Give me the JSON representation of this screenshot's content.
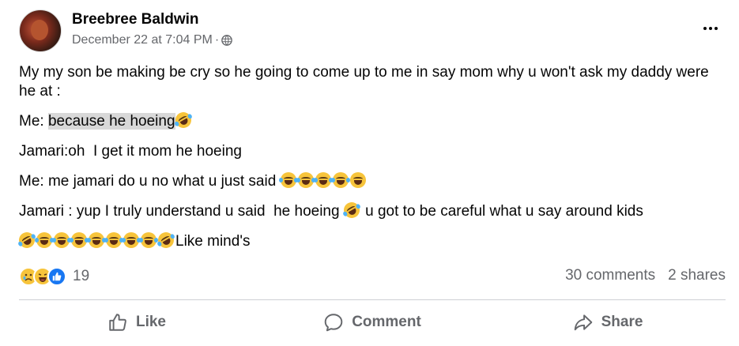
{
  "post": {
    "author": "Breebree Baldwin",
    "timestamp": "December 22 at 7:04 PM",
    "separator": "·",
    "audience_icon": "globe-icon",
    "more_icon": "more-options-icon"
  },
  "content": {
    "line1": "My my son be making be cry so he going to come up to me in say mom why u won't ask my daddy were he at :",
    "line2_prefix": "Me: ",
    "line2_highlight": "because he hoeing",
    "line3": "Jamari:oh  I get it mom he hoeing",
    "line4": "Me: me jamari do u no what u just said ",
    "line5_a": "Jamari : yup I truly understand u said  he hoeing ",
    "line5_b": " u got to be careful what u say around kids",
    "line6_suffix": "Like mind's"
  },
  "stats": {
    "reaction_count": "19",
    "comments": "30 comments",
    "shares": "2 shares",
    "reaction_icons": [
      "sad-reaction-icon",
      "haha-reaction-icon",
      "like-reaction-icon"
    ]
  },
  "actions": {
    "like_label": "Like",
    "comment_label": "Comment",
    "share_label": "Share"
  },
  "colors": {
    "text": "#050505",
    "secondary": "#65676b",
    "like_blue": "#1877f2",
    "emoji_yellow": "#f7c43b",
    "highlight": "#d8d8d8"
  }
}
